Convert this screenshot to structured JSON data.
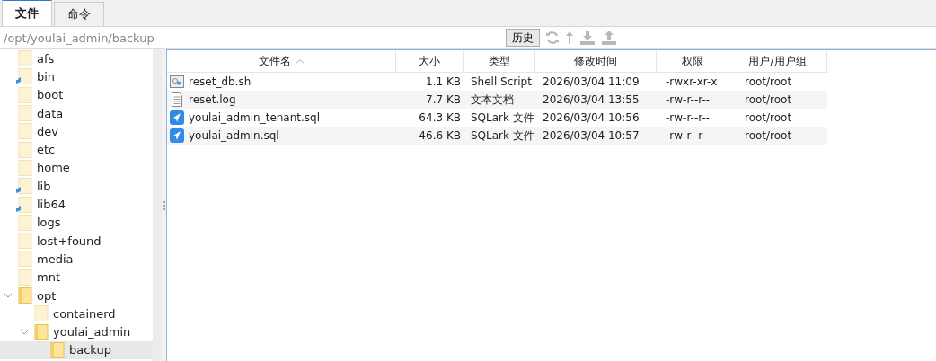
{
  "tabs": [
    {
      "label": "文件",
      "selected": true
    },
    {
      "label": "命令",
      "selected": false
    }
  ],
  "path": {
    "value": "/opt/youlai_admin/backup"
  },
  "history_button": "历史",
  "tree": [
    {
      "name": "afs",
      "kind": "folder"
    },
    {
      "name": "bin",
      "kind": "link"
    },
    {
      "name": "boot",
      "kind": "folder"
    },
    {
      "name": "data",
      "kind": "folder"
    },
    {
      "name": "dev",
      "kind": "folder"
    },
    {
      "name": "etc",
      "kind": "folder"
    },
    {
      "name": "home",
      "kind": "folder"
    },
    {
      "name": "lib",
      "kind": "link"
    },
    {
      "name": "lib64",
      "kind": "link"
    },
    {
      "name": "logs",
      "kind": "folder"
    },
    {
      "name": "lost+found",
      "kind": "folder"
    },
    {
      "name": "media",
      "kind": "folder"
    },
    {
      "name": "mnt",
      "kind": "folder"
    },
    {
      "name": "opt",
      "kind": "folder",
      "expanded": true,
      "children": [
        {
          "name": "containerd",
          "kind": "folder"
        },
        {
          "name": "youlai_admin",
          "kind": "folder",
          "expanded": true,
          "children": [
            {
              "name": "backup",
              "kind": "folder",
              "selected": true
            }
          ]
        }
      ]
    }
  ],
  "table": {
    "columns": [
      {
        "label": "文件名",
        "sorted": true
      },
      {
        "label": "大小",
        "sorted": false
      },
      {
        "label": "类型",
        "sorted": false
      },
      {
        "label": "修改时间",
        "sorted": false
      },
      {
        "label": "权限",
        "sorted": false
      },
      {
        "label": "用户/用户组",
        "sorted": false
      }
    ],
    "rows": [
      {
        "kind": "script",
        "name": "reset_db.sh",
        "size": "1.1 KB",
        "type": "Shell Script",
        "modified": "2026/03/04 11:09",
        "permissions": "-rwxr-xr-x",
        "owner": "root/root"
      },
      {
        "kind": "text",
        "name": "reset.log",
        "size": "7.7 KB",
        "type": "文本文档",
        "modified": "2026/03/04 13:55",
        "permissions": "-rw-r--r--",
        "owner": "root/root"
      },
      {
        "kind": "sqlark",
        "name": "youlai_admin_tenant.sql",
        "size": "64.3 KB",
        "type": "SQLark 文件",
        "modified": "2026/03/04 10:56",
        "permissions": "-rw-r--r--",
        "owner": "root/root"
      },
      {
        "kind": "sqlark",
        "name": "youlai_admin.sql",
        "size": "46.6 KB",
        "type": "SQLark 文件",
        "modified": "2026/03/04 10:57",
        "permissions": "-rw-r--r--",
        "owner": "root/root"
      }
    ]
  }
}
